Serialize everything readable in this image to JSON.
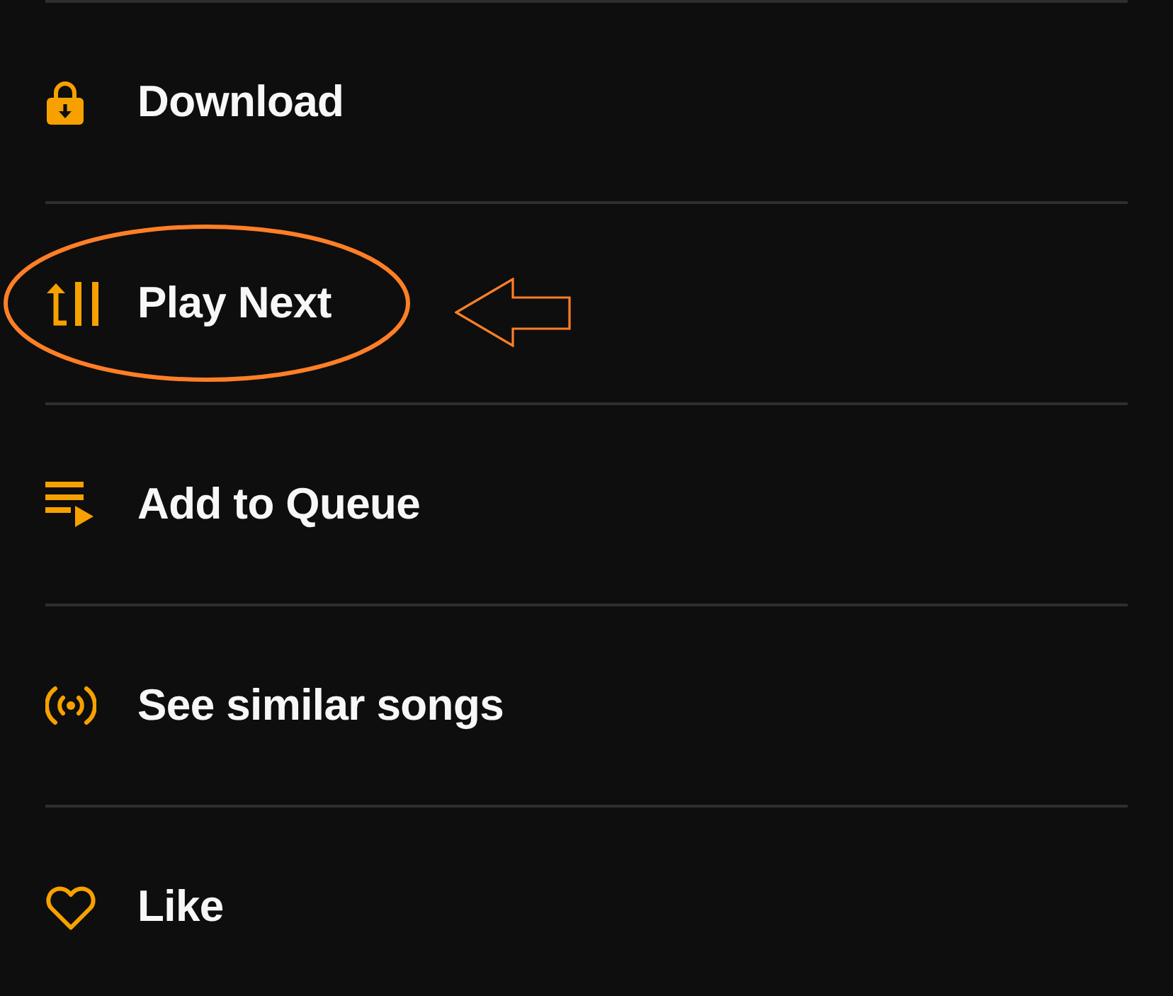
{
  "menu": {
    "items": [
      {
        "kind": "download",
        "label": "Download",
        "highlighted": false
      },
      {
        "kind": "next",
        "label": "Play Next",
        "highlighted": true
      },
      {
        "kind": "queue",
        "label": "Add to Queue",
        "highlighted": false
      },
      {
        "kind": "similar",
        "label": "See similar songs",
        "highlighted": false
      },
      {
        "kind": "like",
        "label": "Like",
        "highlighted": false
      }
    ]
  }
}
